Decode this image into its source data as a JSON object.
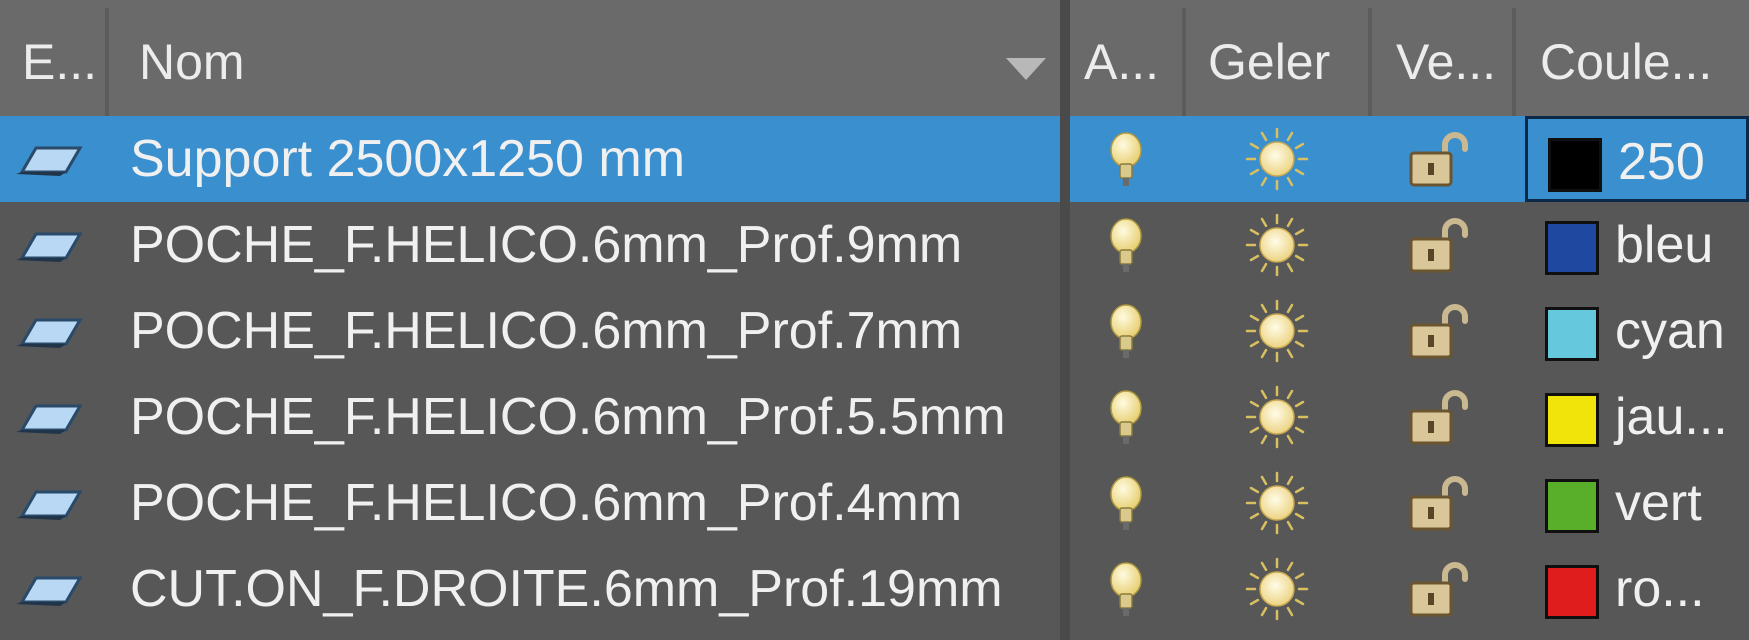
{
  "headers": {
    "status": "E...",
    "name": "Nom",
    "on": "A...",
    "freeze": "Geler",
    "lock": "Ve...",
    "color": "Coule..."
  },
  "layers": [
    {
      "name": "Support 2500x1250 mm",
      "color_hex": "#000000",
      "color_label": "250",
      "selected": true
    },
    {
      "name": "POCHE_F.HELICO.6mm_Prof.9mm",
      "color_hex": "#1f48a0",
      "color_label": "bleu",
      "selected": false
    },
    {
      "name": "POCHE_F.HELICO.6mm_Prof.7mm",
      "color_hex": "#66c8dc",
      "color_label": "cyan",
      "selected": false
    },
    {
      "name": "POCHE_F.HELICO.6mm_Prof.5.5mm",
      "color_hex": "#f1e40a",
      "color_label": "jau...",
      "selected": false
    },
    {
      "name": "POCHE_F.HELICO.6mm_Prof.4mm",
      "color_hex": "#5aaf2a",
      "color_label": "vert",
      "selected": false
    },
    {
      "name": "CUT.ON_F.DROITE.6mm_Prof.19mm",
      "color_hex": "#e01d1d",
      "color_label": "ro...",
      "selected": false
    }
  ],
  "icons": {
    "layer": "layer-icon",
    "on": "lightbulb-icon",
    "freeze": "sun-icon",
    "lock": "unlocked-padlock-icon"
  },
  "colors": {
    "selection": "#3a8fcf",
    "background": "#575757",
    "header": "#6a6a6a"
  }
}
